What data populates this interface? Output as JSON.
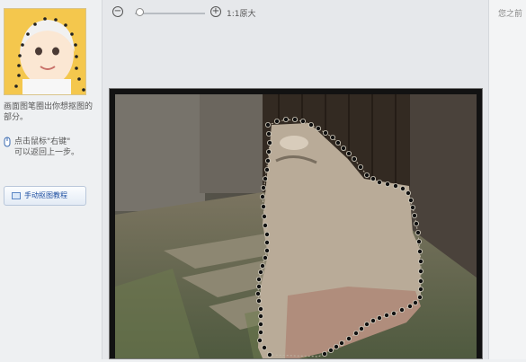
{
  "toolbar": {
    "zoom_out_icon": "zoom-out-icon",
    "zoom_in_icon": "zoom-in-icon",
    "actual_size_label": "1:1原大",
    "zoom_level": 0.05
  },
  "left": {
    "help_line1": "画面图笔圈出你想抠图的",
    "help_line2": "部分。",
    "tip_line1": "点击鼠标\"右键\"",
    "tip_line2": "可以返回上一步。",
    "manual_button_label": "手动抠图教程"
  },
  "right": {
    "text": "您之前"
  },
  "colors": {
    "accent": "#1e4fa1",
    "lasso_point": "#111111",
    "thumbnail_bg": "#f4c74d"
  }
}
